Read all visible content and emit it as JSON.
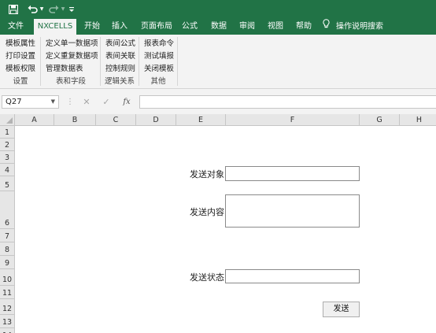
{
  "quick_access": {
    "save_icon": "save-icon",
    "undo_icon": "undo-icon",
    "redo_icon": "redo-icon",
    "customize_icon": "customize-icon"
  },
  "tabs": [
    {
      "label": "文件"
    },
    {
      "label": "NXCELLS"
    },
    {
      "label": "开始"
    },
    {
      "label": "插入"
    },
    {
      "label": "页面布局"
    },
    {
      "label": "公式"
    },
    {
      "label": "数据"
    },
    {
      "label": "审阅"
    },
    {
      "label": "视图"
    },
    {
      "label": "帮助"
    }
  ],
  "tell_me": {
    "label": "操作说明搜索",
    "icon": "lightbulb-icon"
  },
  "ribbon": {
    "groups": [
      {
        "label": "设置",
        "items": [
          "模板属性",
          "打印设置",
          "模板权限"
        ]
      },
      {
        "label": "表和字段",
        "items": [
          "定义单一数据项",
          "定义重复数据项",
          "管理数据表"
        ]
      },
      {
        "label": "逻辑关系",
        "items": [
          "表间公式",
          "表间关联",
          "控制规则"
        ]
      },
      {
        "label": "其他",
        "items": [
          "报表命令",
          "测试填报",
          "关闭模板"
        ]
      }
    ]
  },
  "formula_bar": {
    "name_box": "Q27",
    "cancel_icon": "cancel-icon",
    "enter_icon": "enter-icon",
    "fx_label": "fx",
    "value": ""
  },
  "sheet": {
    "columns": [
      "A",
      "B",
      "C",
      "D",
      "E",
      "F",
      "G",
      "H"
    ],
    "rows": [
      "1",
      "2",
      "3",
      "4",
      "5",
      "6",
      "7",
      "8",
      "9",
      "10",
      "11",
      "12",
      "13",
      "14"
    ],
    "form": {
      "recipient_label": "发送对象",
      "recipient_value": "",
      "content_label": "发送内容",
      "content_value": "",
      "status_label": "发送状态",
      "status_value": "",
      "send_button": "发送"
    }
  },
  "colors": {
    "accent": "#217346",
    "ribbon_bg": "#f3f3f3",
    "header_bg": "#e6e6e6"
  }
}
